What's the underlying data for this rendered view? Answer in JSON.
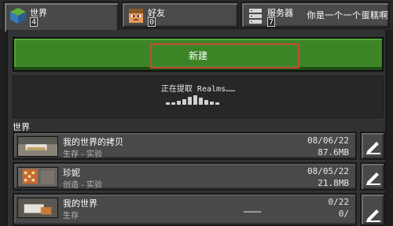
{
  "tabs": [
    {
      "label": "世界",
      "count": "4",
      "icon": "world-grass-block-icon"
    },
    {
      "label": "好友",
      "count": "0",
      "icon": "friend-head-icon"
    },
    {
      "label": "服务器",
      "count": "7",
      "icon": "server-icon"
    }
  ],
  "header": {
    "user_name": "你是一个一个蛋糕啊"
  },
  "create_button": {
    "label": "新建"
  },
  "realms": {
    "status": "正在提取 Realms……"
  },
  "worlds_section": {
    "title": "世界"
  },
  "worlds": [
    {
      "name": "我的世界的拷贝",
      "mode": "生存 - 实验",
      "date": "08/06/22",
      "size": "87.6MB"
    },
    {
      "name": "珍妮",
      "mode": "创造 - 实验",
      "date": "08/05/22",
      "size": "21.8MB"
    },
    {
      "name": "我的世界",
      "mode": "生存",
      "date": "0/22",
      "size": "0/"
    }
  ],
  "colors": {
    "create_button": "#3c8527",
    "highlight": "#c24a33",
    "panel": "#313233"
  }
}
